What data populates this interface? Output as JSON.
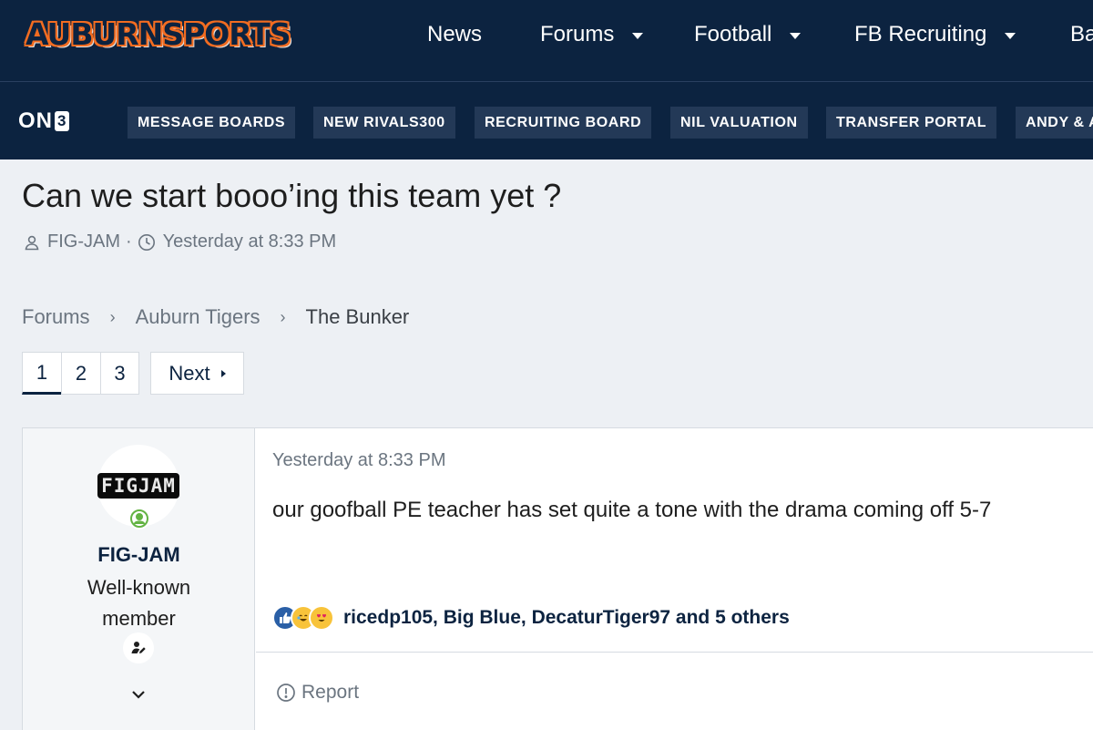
{
  "header": {
    "logo_text": "AUBURNSPORTS",
    "nav": [
      {
        "label": "News",
        "has_caret": false
      },
      {
        "label": "Forums",
        "has_caret": true
      },
      {
        "label": "Football",
        "has_caret": true
      },
      {
        "label": "FB Recruiting",
        "has_caret": true
      },
      {
        "label": "Ba",
        "has_caret": false
      }
    ]
  },
  "subnav": {
    "brand": "ON",
    "brand_digit": "3",
    "pills": [
      "MESSAGE BOARDS",
      "NEW RIVALS300",
      "RECRUITING BOARD",
      "NIL VALUATION",
      "TRANSFER PORTAL",
      "ANDY & A"
    ]
  },
  "thread": {
    "title": "Can we start booo’ing this team yet ?",
    "author": "FIG-JAM",
    "meta_sep": "·",
    "timestamp": "Yesterday at 8:33 PM"
  },
  "breadcrumb": {
    "items": [
      "Forums",
      "Auburn Tigers",
      "The Bunker"
    ],
    "separator": "›"
  },
  "pagination": {
    "pages": [
      "1",
      "2",
      "3"
    ],
    "current": "1",
    "next_label": "Next"
  },
  "post": {
    "avatar_text": "FIGJAM",
    "username": "FIG-JAM",
    "user_title_line1": "Well-known",
    "user_title_line2": "member",
    "date": "Yesterday at 8:33 PM",
    "body": "our goofball PE teacher has set quite a tone with the drama coming off 5-7",
    "reactions_text": "ricedp105, Big Blue, DecaturTiger97 and 5 others",
    "report_label": "Report"
  },
  "colors": {
    "navy": "#0c2340",
    "orange": "#f26c21",
    "pill_bg": "#233957",
    "page_bg": "#edf0f4",
    "online_green": "#63b343"
  },
  "icons": {
    "author": "user-icon",
    "time": "clock-icon",
    "online": "online-status-icon",
    "badge": "user-pen-icon",
    "expand": "chevron-down-icon",
    "report": "alert-circle-icon"
  }
}
